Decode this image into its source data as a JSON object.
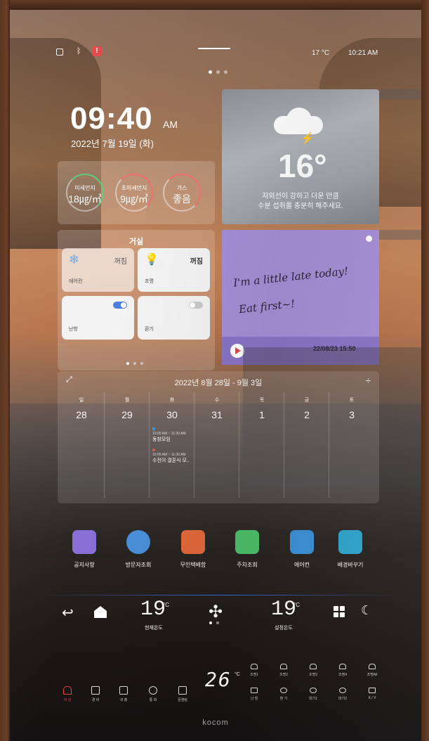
{
  "status_bar": {
    "temperature": "17 °C",
    "time": "10:21 AM"
  },
  "clock": {
    "time": "09:40",
    "ampm": "AM",
    "date": "2022년 7월 19일 (화)"
  },
  "air_quality": [
    {
      "label": "미세먼지",
      "value": "18㎍/㎥"
    },
    {
      "label": "초미세먼지",
      "value": "9㎍/㎥"
    },
    {
      "label": "가스",
      "value": "좋음"
    }
  ],
  "weather": {
    "temperature": "16°",
    "message_line1": "자외선이 강하고 더운 만큼",
    "message_line2": "수분 섭취를 충분히 해주세요."
  },
  "room": {
    "title": "거실",
    "tiles": [
      {
        "name": "에어컨",
        "state": "꺼짐"
      },
      {
        "name": "조명",
        "state": "꺼짐"
      },
      {
        "name": "난방",
        "state": ""
      },
      {
        "name": "환기",
        "state": ""
      }
    ]
  },
  "memo": {
    "line1": "I'm a little late today!",
    "line2": "Eat first~!",
    "timestamp": "22/08/23 15:50"
  },
  "calendar": {
    "range": "2022년 8월 28일 - 9월 3일",
    "days": [
      {
        "weekday": "일",
        "date": "28"
      },
      {
        "weekday": "월",
        "date": "29"
      },
      {
        "weekday": "화",
        "date": "30"
      },
      {
        "weekday": "수",
        "date": "31"
      },
      {
        "weekday": "목",
        "date": "1"
      },
      {
        "weekday": "금",
        "date": "2"
      },
      {
        "weekday": "토",
        "date": "3"
      }
    ],
    "events": [
      {
        "time": "10:00 AM ~ 11:30 AM",
        "title": "동창모임"
      },
      {
        "time": "10:00 AM ~ 11:30 AM",
        "title": "수진이 결혼식 모.."
      }
    ]
  },
  "apps": [
    {
      "label": "공지사항",
      "color": "#8a6fd8"
    },
    {
      "label": "방문자조회",
      "color": "#4a90d9"
    },
    {
      "label": "무인택배함",
      "color": "#e0683a"
    },
    {
      "label": "주차조회",
      "color": "#4cbf6a"
    },
    {
      "label": "에어컨",
      "color": "#3b8fd6"
    },
    {
      "label": "배경바꾸기",
      "color": "#2fa3c9"
    }
  ],
  "dock": {
    "current_temp": "19",
    "current_label": "현재온도",
    "set_temp": "19",
    "set_label": "설정온도",
    "unit": "°C"
  },
  "hard_buttons": {
    "left": [
      "비 상",
      "경 비",
      "귀 출",
      "통 화",
      "문열림"
    ],
    "display": "26",
    "unit": "°C",
    "top_row": [
      "조명1",
      "조명2",
      "조명3",
      "조명4",
      "조명All"
    ],
    "bottom_row": [
      "난 방",
      "환 기",
      "대기1",
      "대기2",
      "K / V"
    ]
  },
  "brand": "kocom"
}
